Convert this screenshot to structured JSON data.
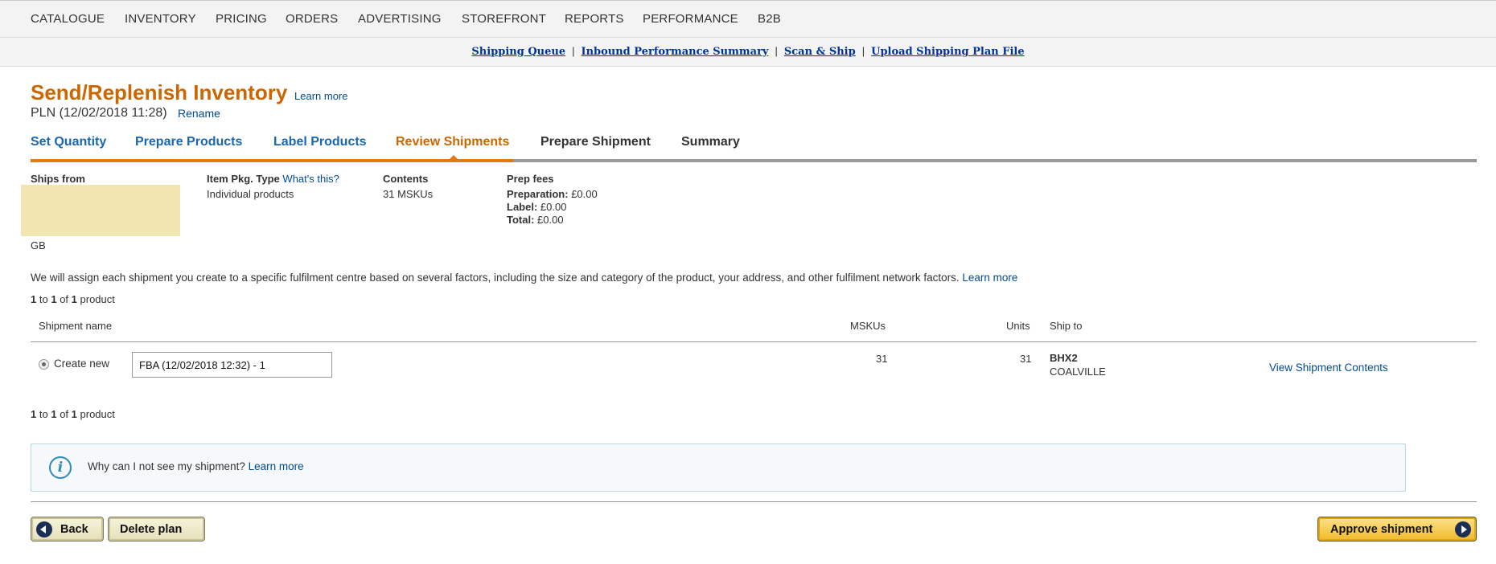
{
  "topnav": {
    "items": [
      "CATALOGUE",
      "INVENTORY",
      "PRICING",
      "ORDERS",
      "ADVERTISING",
      "STOREFRONT",
      "REPORTS",
      "PERFORMANCE",
      "B2B"
    ]
  },
  "subnav": {
    "links": [
      "Shipping Queue",
      "Inbound Performance Summary",
      "Scan & Ship",
      "Upload Shipping Plan File"
    ],
    "separator": "|"
  },
  "header": {
    "title": "Send/Replenish Inventory",
    "learn_more": "Learn more",
    "plan_name": "PLN (12/02/2018 11:28)",
    "rename": "Rename"
  },
  "tabs": [
    {
      "label": "Set Quantity",
      "state": "done"
    },
    {
      "label": "Prepare Products",
      "state": "done"
    },
    {
      "label": "Label Products",
      "state": "done"
    },
    {
      "label": "Review Shipments",
      "state": "active"
    },
    {
      "label": "Prepare Shipment",
      "state": "todo"
    },
    {
      "label": "Summary",
      "state": "todo"
    }
  ],
  "info": {
    "ships_from_label": "Ships from",
    "ships_from_country": "GB",
    "pkg_type_label": "Item Pkg. Type",
    "pkg_type_help": "What's this?",
    "pkg_type_value": "Individual products",
    "contents_label": "Contents",
    "contents_value": "31 MSKUs",
    "prep_fees_label": "Prep fees",
    "preparation_label": "Preparation:",
    "preparation_value": "£0.00",
    "label_label": "Label:",
    "label_value": "£0.00",
    "total_label": "Total:",
    "total_value": "£0.00"
  },
  "assign_notice": {
    "text": "We will assign each shipment you create to a specific fulfilment centre based on several factors, including the size and category of the product, your address, and other fulfilment network factors.",
    "link": "Learn more"
  },
  "pagination": {
    "from": "1",
    "to_word": "to",
    "to": "1",
    "of_word": "of",
    "total": "1",
    "unit": "product"
  },
  "table": {
    "headers": {
      "name": "Shipment name",
      "mskus": "MSKUs",
      "units": "Units",
      "ship_to": "Ship to"
    },
    "row": {
      "option_label": "Create new",
      "shipment_name": "FBA (12/02/2018 12:32) - 1",
      "mskus": "31",
      "units": "31",
      "fc_code": "BHX2",
      "fc_city": "COALVILLE",
      "view_link": "View Shipment Contents"
    }
  },
  "help_box": {
    "icon": "info-icon",
    "text": "Why can I not see my shipment?",
    "link": "Learn more"
  },
  "buttons": {
    "back": "Back",
    "delete": "Delete plan",
    "approve": "Approve shipment"
  }
}
